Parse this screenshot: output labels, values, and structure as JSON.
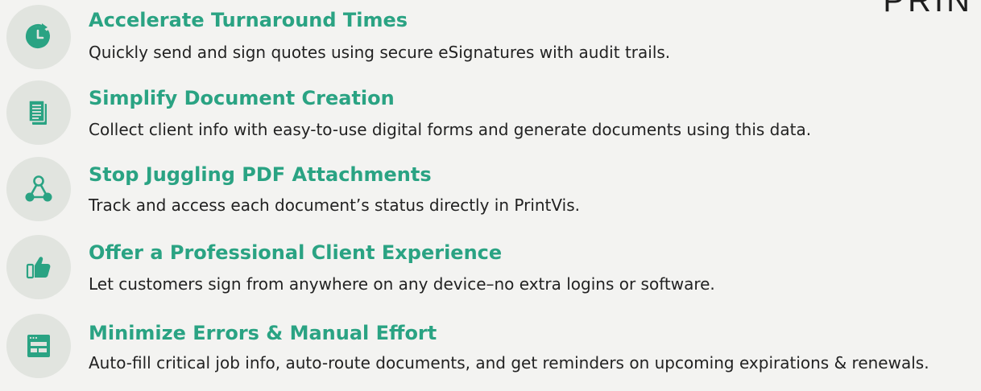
{
  "brand": {
    "text": "PRIN"
  },
  "features": [
    {
      "icon": "clock-refresh-icon",
      "title": "Accelerate Turnaround Times",
      "description": "Quickly send and sign quotes using secure eSignatures with audit trails."
    },
    {
      "icon": "document-stack-icon",
      "title": "Simplify Document Creation",
      "description": "Collect client info with easy-to-use digital forms and generate documents using this data."
    },
    {
      "icon": "connected-nodes-icon",
      "title": "Stop Juggling PDF Attachments",
      "description": "Track and access each document’s status directly in PrintVis."
    },
    {
      "icon": "thumbs-up-icon",
      "title": "Offer a Professional Client Experience",
      "description": "Let customers sign from anywhere on any device–no extra logins or software."
    },
    {
      "icon": "browser-form-icon",
      "title": "Minimize Errors & Manual Effort",
      "description": "Auto-fill critical job info, auto-route documents, and get reminders on upcoming expirations & renewals."
    }
  ],
  "colors": {
    "accent": "#2aa383",
    "icon_bg": "#e1e4df",
    "background": "#f3f3f1",
    "text": "#222222"
  }
}
